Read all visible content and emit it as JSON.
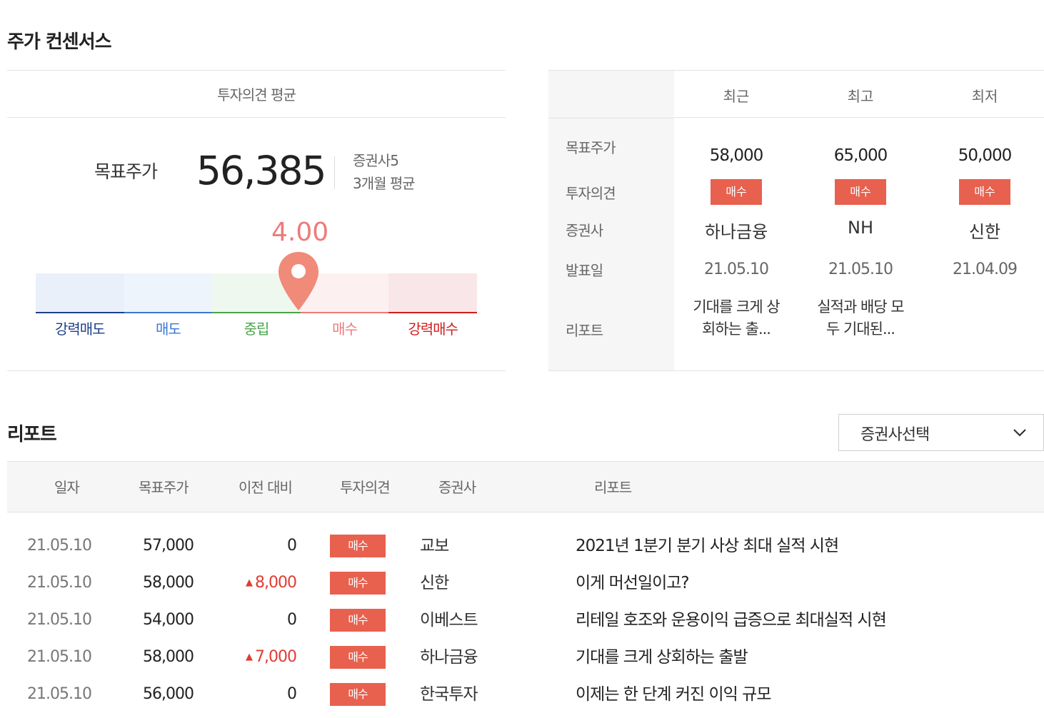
{
  "consensus": {
    "title": "주가 컨센서스",
    "avg_header": "투자의견 평균",
    "target_label": "목표주가",
    "target_value": "56,385",
    "firm_count": "증권사5",
    "period": "3개월 평균",
    "opinion_score": "4.00",
    "opinion_score_value": 4.0,
    "gauge_labels": [
      "강력매도",
      "매도",
      "중립",
      "매수",
      "강력매수"
    ],
    "colors": {
      "strong_sell": "#1e3f8a",
      "sell": "#3b78d0",
      "neutral": "#4aa34a",
      "buy": "#ec7b7b",
      "strong_buy": "#cf1e1e",
      "badge": "#e8604e",
      "pin": "#f08a79"
    }
  },
  "summary": {
    "headers": [
      "최근",
      "최고",
      "최저"
    ],
    "row_labels": [
      "목표주가",
      "투자의견",
      "증권사",
      "발표일",
      "리포트"
    ],
    "columns": [
      {
        "price": "58,000",
        "opinion": "매수",
        "firm": "하나금융",
        "date": "21.05.10",
        "report_l1": "기대를 크게 상",
        "report_l2": "회하는 출..."
      },
      {
        "price": "65,000",
        "opinion": "매수",
        "firm": "NH",
        "date": "21.05.10",
        "report_l1": "실적과 배당 모",
        "report_l2": "두 기대된..."
      },
      {
        "price": "50,000",
        "opinion": "매수",
        "firm": "신한",
        "date": "21.04.09",
        "report_l1": "",
        "report_l2": ""
      }
    ]
  },
  "reports": {
    "title": "리포트",
    "broker_select": "증권사선택",
    "columns": [
      "일자",
      "목표주가",
      "이전 대비",
      "투자의견",
      "증권사",
      "리포트"
    ],
    "rows": [
      {
        "date": "21.05.10",
        "price": "57,000",
        "change": "0",
        "opinion": "매수",
        "firm": "교보",
        "title": "2021년 1분기 분기 사상 최대 실적 시현"
      },
      {
        "date": "21.05.10",
        "price": "58,000",
        "change": "8,000",
        "opinion": "매수",
        "firm": "신한",
        "title": "이게 머선일이고?"
      },
      {
        "date": "21.05.10",
        "price": "54,000",
        "change": "0",
        "opinion": "매수",
        "firm": "이베스트",
        "title": "리테일 호조와 운용이익 급증으로 최대실적 시현"
      },
      {
        "date": "21.05.10",
        "price": "58,000",
        "change": "7,000",
        "opinion": "매수",
        "firm": "하나금융",
        "title": "기대를 크게 상회하는 출발"
      },
      {
        "date": "21.05.10",
        "price": "56,000",
        "change": "0",
        "opinion": "매수",
        "firm": "한국투자",
        "title": "이제는 한 단계 커진 이익 규모"
      }
    ]
  }
}
